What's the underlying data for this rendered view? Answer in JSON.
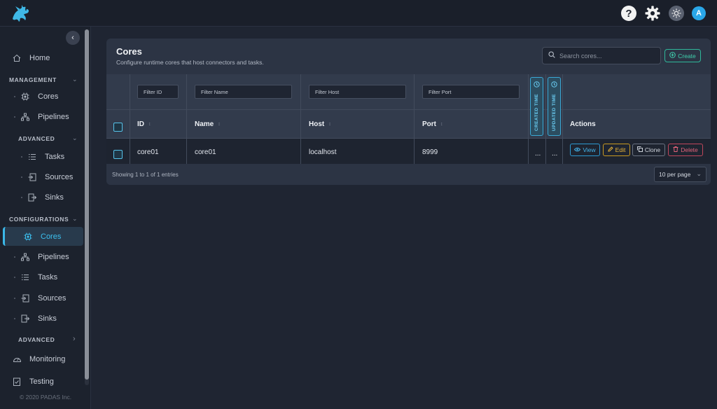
{
  "topbar": {
    "avatar_initial": "A",
    "icons": [
      "help-icon",
      "gear-icon",
      "theme-toggle-icon"
    ]
  },
  "sidebar": {
    "home": "Home",
    "management_label": "MANAGEMENT",
    "management_items": [
      "Cores",
      "Pipelines"
    ],
    "advanced_label": "ADVANCED",
    "advanced_items": [
      "Tasks",
      "Sources",
      "Sinks"
    ],
    "configurations_label": "CONFIGURATIONS",
    "configurations_items": [
      "Cores",
      "Pipelines",
      "Tasks",
      "Sources",
      "Sinks"
    ],
    "config_advanced_label": "ADVANCED",
    "monitoring": "Monitoring",
    "testing": "Testing",
    "copyright": "© 2020 PADAS Inc."
  },
  "page": {
    "title": "Cores",
    "subtitle": "Configure runtime cores that host connectors and tasks.",
    "search_placeholder": "Search cores...",
    "create_label": "Create"
  },
  "table": {
    "filters": {
      "id": "Filter ID",
      "name": "Filter Name",
      "host": "Filter Host",
      "port": "Filter Port"
    },
    "columns": {
      "id": "ID",
      "name": "Name",
      "host": "Host",
      "port": "Port",
      "created": "CREATED TIME",
      "updated": "UPDATED TIME",
      "actions": "Actions"
    },
    "rows": [
      {
        "id": "core01",
        "name": "core01",
        "host": "localhost",
        "port": "8999",
        "created": "...",
        "updated": "..."
      }
    ],
    "actions": {
      "view": "View",
      "edit": "Edit",
      "clone": "Clone",
      "delete": "Delete"
    },
    "showing": "Showing 1 to 1 of 1 entries",
    "per_page": "10 per page"
  },
  "colors": {
    "accent": "#3bb8e8",
    "create": "#3fd1ae",
    "edit": "#e7b43a",
    "delete": "#e2637a"
  }
}
